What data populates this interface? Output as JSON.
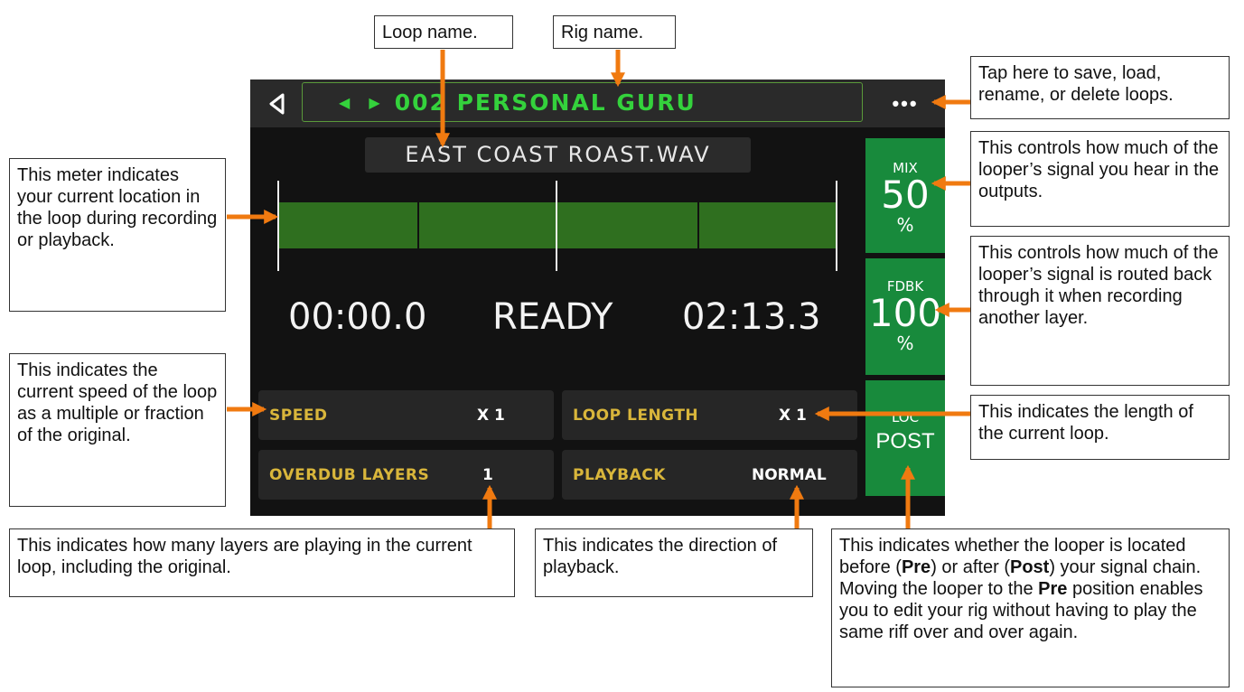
{
  "device": {
    "rig_name": "002 PERSONAL GURU",
    "rig_nav_arrows": "◀ ▶",
    "more_button": "•••",
    "loop_name": "EAST COAST ROAST.WAV",
    "time_current": "00:00.0",
    "status": "READY",
    "time_total": "02:13.3",
    "params": {
      "speed_label": "SPEED",
      "speed_value": "X 1",
      "loop_length_label": "LOOP LENGTH",
      "loop_length_value": "X 1",
      "overdub_label": "OVERDUB LAYERS",
      "overdub_value": "1",
      "playback_label": "PLAYBACK",
      "playback_value": "NORMAL"
    },
    "side": {
      "mix_label": "MIX",
      "mix_value": "50",
      "mix_unit": "%",
      "fdbk_label": "FDBK",
      "fdbk_value": "100",
      "fdbk_unit": "%",
      "loc_label": "LOC",
      "loc_value": "POST"
    }
  },
  "callouts": {
    "loop_name": "Loop name.",
    "rig_name": "Rig name.",
    "tap_here": "Tap here to save, load, rename, or delete loops.",
    "mix": "This controls how much of the looper’s signal you hear in the outputs.",
    "fdbk": "This controls how much of the looper’s signal is routed back through it when recording another layer.",
    "meter": "This meter indicates your current location in the loop during recording or playback.",
    "speed": "This indicates the current speed of the loop as a multiple or fraction of the original.",
    "loop_length": "This indicates the length of the current loop.",
    "overdub": "This indicates how many layers are playing in the current loop, including the original.",
    "playback": "This indicates the direction of playback.",
    "loc_prefix": "This indicates whether the looper is located before (",
    "loc_pre1": "Pre",
    "loc_mid1": ") or after (",
    "loc_post": "Post",
    "loc_mid2": ") your signal chain. Moving the looper to the ",
    "loc_pre2": "Pre",
    "loc_suffix": " position enables you to edit your rig without having to play the same riff over and over again."
  },
  "colors": {
    "accent_green": "#34d23c",
    "param_label": "#d9b63b",
    "side_panel": "#188a3c",
    "arrow": "#f07a10"
  },
  "icons": [
    "back-triangle-icon",
    "left-arrow-icon",
    "right-arrow-icon",
    "more-dots-icon"
  ]
}
